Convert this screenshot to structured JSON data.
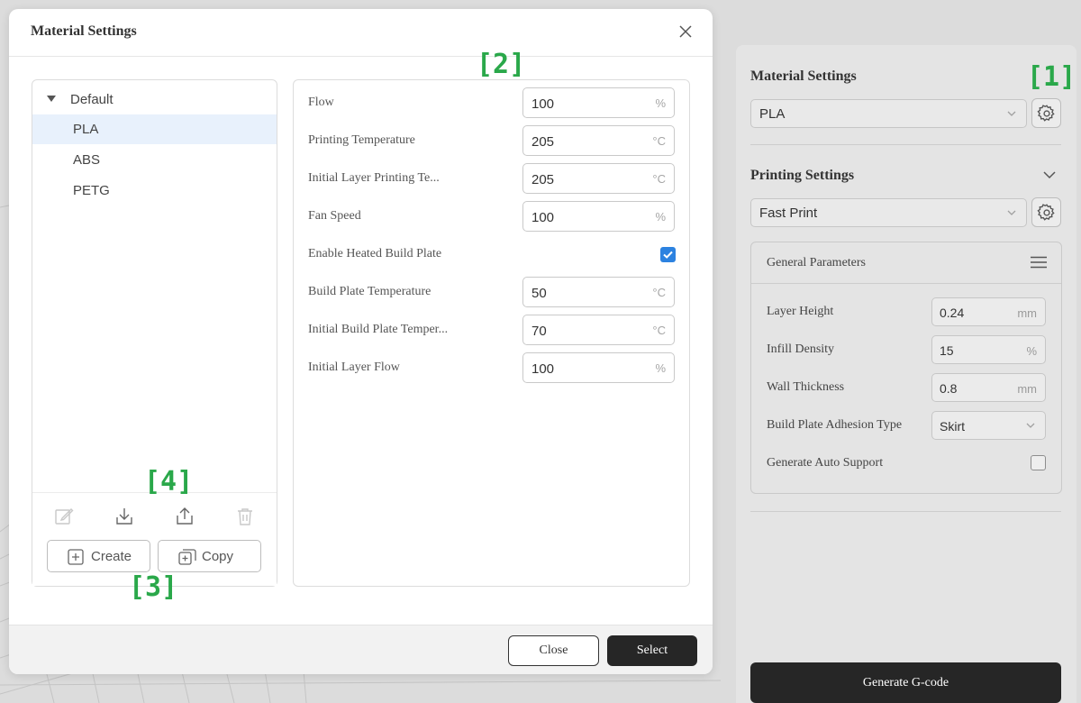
{
  "dialog": {
    "title": "Material Settings",
    "tree": {
      "group_label": "Default",
      "items": [
        "PLA",
        "ABS",
        "PETG"
      ],
      "selected": "PLA"
    },
    "toolbar": {
      "edit_icon": "edit-icon",
      "import_icon": "import-icon",
      "export_icon": "export-icon",
      "delete_icon": "trash-icon",
      "create_label": "Create",
      "copy_label": "Copy"
    },
    "form": {
      "fields": [
        {
          "label": "Flow",
          "value": "100",
          "unit": "%"
        },
        {
          "label": "Printing Temperature",
          "value": "205",
          "unit": "°C"
        },
        {
          "label": "Initial Layer Printing Te...",
          "value": "205",
          "unit": "°C"
        },
        {
          "label": "Fan Speed",
          "value": "100",
          "unit": "%"
        },
        {
          "label": "Enable Heated Build Plate",
          "checked": true
        },
        {
          "label": "Build Plate Temperature",
          "value": "50",
          "unit": "°C"
        },
        {
          "label": "Initial Build Plate Temper...",
          "value": "70",
          "unit": "°C"
        },
        {
          "label": "Initial Layer Flow",
          "value": "100",
          "unit": "%"
        }
      ]
    },
    "footer": {
      "close_label": "Close",
      "select_label": "Select"
    }
  },
  "side_panel": {
    "material": {
      "title": "Material Settings",
      "selected": "PLA"
    },
    "printing": {
      "title": "Printing Settings",
      "selected": "Fast Print"
    },
    "general": {
      "title": "General Parameters",
      "layer_height": {
        "label": "Layer Height",
        "value": "0.24",
        "unit": "mm"
      },
      "infill_density": {
        "label": "Infill Density",
        "value": "15",
        "unit": "%"
      },
      "wall_thickness": {
        "label": "Wall Thickness",
        "value": "0.8",
        "unit": "mm"
      },
      "adhesion": {
        "label": "Build Plate Adhesion Type",
        "value": "Skirt"
      },
      "auto_support": {
        "label": "Generate Auto Support",
        "checked": false
      }
    },
    "generate_label": "Generate G-code"
  },
  "annotations": [
    "[1]",
    "[2]",
    "[3]",
    "[4]"
  ],
  "colors": {
    "accent": "#2c82e0",
    "annotation": "#2aa84a",
    "primary_button": "#262626"
  }
}
